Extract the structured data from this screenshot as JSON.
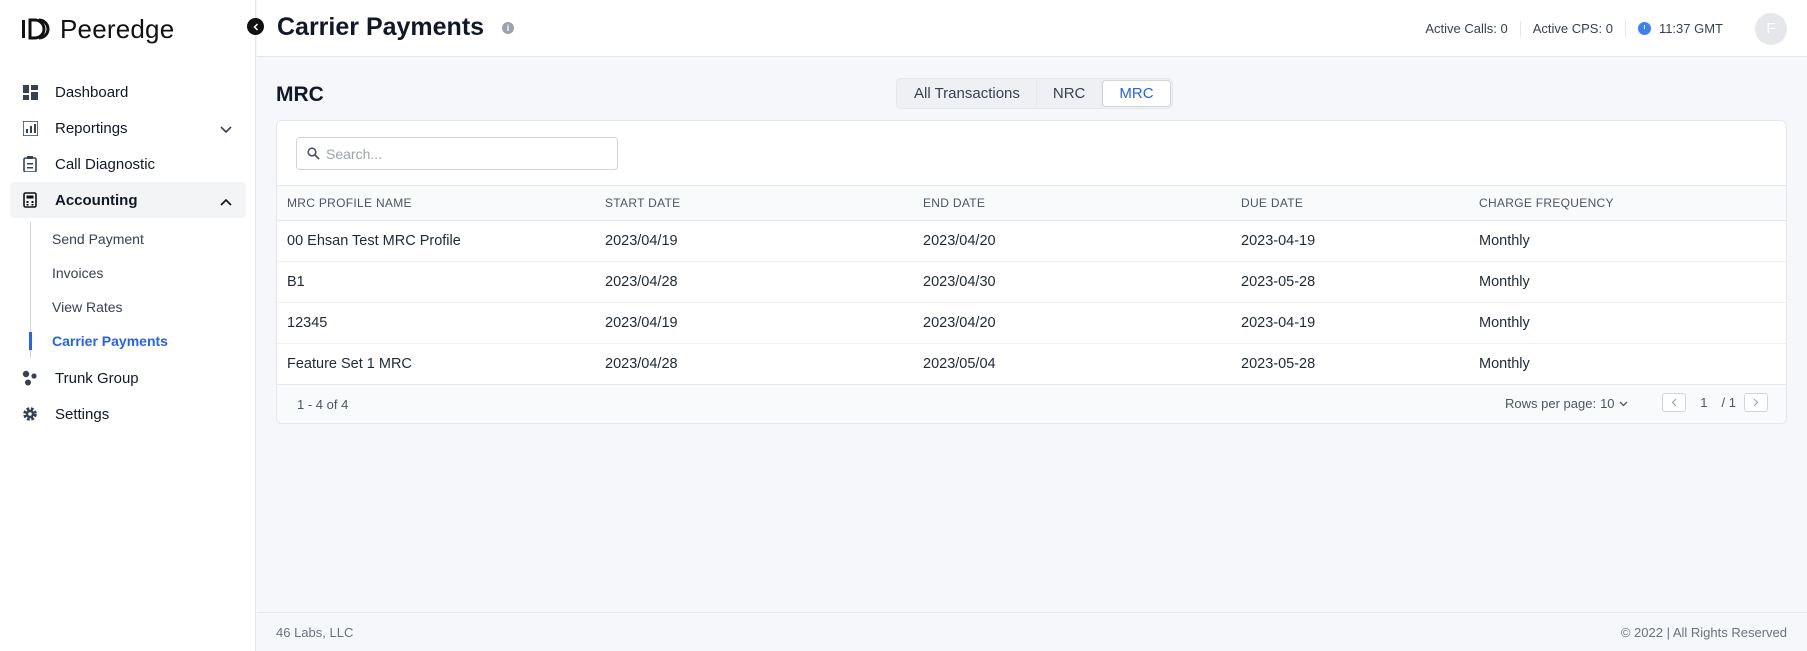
{
  "brand": {
    "name": "Peeredge"
  },
  "sidebar": {
    "items": [
      {
        "label": "Dashboard",
        "icon": "dashboard-icon"
      },
      {
        "label": "Reportings",
        "icon": "reportings-icon"
      },
      {
        "label": "Call Diagnostic",
        "icon": "call-diagnostic-icon"
      },
      {
        "label": "Accounting",
        "icon": "calculator-icon"
      },
      {
        "label": "Trunk Group",
        "icon": "trunk-group-icon"
      },
      {
        "label": "Settings",
        "icon": "gear-icon"
      }
    ],
    "accounting_sub": [
      {
        "label": "Send Payment"
      },
      {
        "label": "Invoices"
      },
      {
        "label": "View Rates"
      },
      {
        "label": "Carrier Payments"
      }
    ]
  },
  "header": {
    "title": "Carrier Payments",
    "active_calls": "Active Calls: 0",
    "active_cps": "Active CPS: 0",
    "time": "11:37 GMT",
    "avatar_initial": "F"
  },
  "main": {
    "section_title": "MRC",
    "tabs": [
      {
        "label": "All Transactions"
      },
      {
        "label": "NRC"
      },
      {
        "label": "MRC"
      }
    ],
    "search_placeholder": "Search...",
    "columns": [
      "MRC PROFILE NAME",
      "START DATE",
      "END DATE",
      "DUE DATE",
      "CHARGE FREQUENCY"
    ],
    "rows": [
      [
        "00 Ehsan Test MRC Profile",
        "2023/04/19",
        "2023/04/20",
        "2023-04-19",
        "Monthly"
      ],
      [
        "B1",
        "2023/04/28",
        "2023/04/30",
        "2023-05-28",
        "Monthly"
      ],
      [
        "12345",
        "2023/04/19",
        "2023/04/20",
        "2023-04-19",
        "Monthly"
      ],
      [
        "Feature Set 1 MRC",
        "2023/04/28",
        "2023/05/04",
        "2023-05-28",
        "Monthly"
      ]
    ],
    "range_text": "1 - 4 of 4",
    "rows_per_page_label": "Rows per page:",
    "rows_per_page_value": "10",
    "page_current": "1",
    "page_total": "/ 1"
  },
  "footer": {
    "left": "46 Labs, LLC",
    "right": "© 2022 | All Rights Reserved"
  },
  "colors": {
    "accent": "#2563eb",
    "clock": "#3b82f6"
  }
}
